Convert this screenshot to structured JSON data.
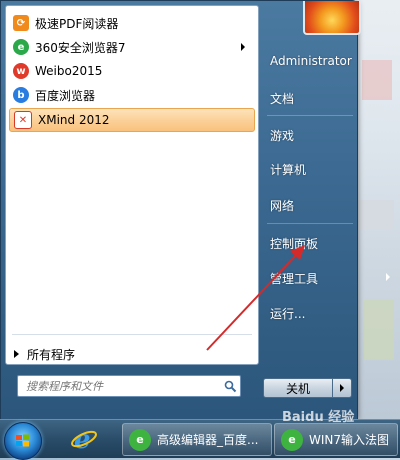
{
  "left_pane": {
    "programs": [
      {
        "label": "极速PDF阅读器",
        "icon": "pdf-reader-icon",
        "color": "#f08a1c"
      },
      {
        "label": "360安全浏览器7",
        "icon": "360-browser-icon",
        "color": "#2aa84a",
        "has_submenu": true
      },
      {
        "label": "Weibo2015",
        "icon": "weibo-icon",
        "color": "#e03a2a"
      },
      {
        "label": "百度浏览器",
        "icon": "baidu-browser-icon",
        "color": "#2a7de0"
      },
      {
        "label": "XMind 2012",
        "icon": "xmind-icon",
        "color": "#d83a2a",
        "selected": true
      }
    ],
    "all_programs": "所有程序",
    "search_placeholder": "搜索程序和文件"
  },
  "right_pane": {
    "items": [
      {
        "label": "Administrator"
      },
      {
        "label": "文档"
      },
      {
        "label": "游戏"
      },
      {
        "label": "计算机"
      },
      {
        "label": "网络"
      },
      {
        "label": "控制面板"
      },
      {
        "label": "管理工具",
        "has_submenu": true
      },
      {
        "label": "运行..."
      }
    ],
    "shutdown_label": "关机"
  },
  "taskbar": {
    "tasks": [
      {
        "label": "高级编辑器_百度...",
        "icon": "360-browser-icon"
      },
      {
        "label": "WIN7输入法图",
        "icon": "360-browser-icon"
      }
    ],
    "watermark": "Baidu 经验"
  },
  "colors": {
    "selected_highlight": "#fbd199",
    "annotation_arrow": "#d42a2a"
  }
}
